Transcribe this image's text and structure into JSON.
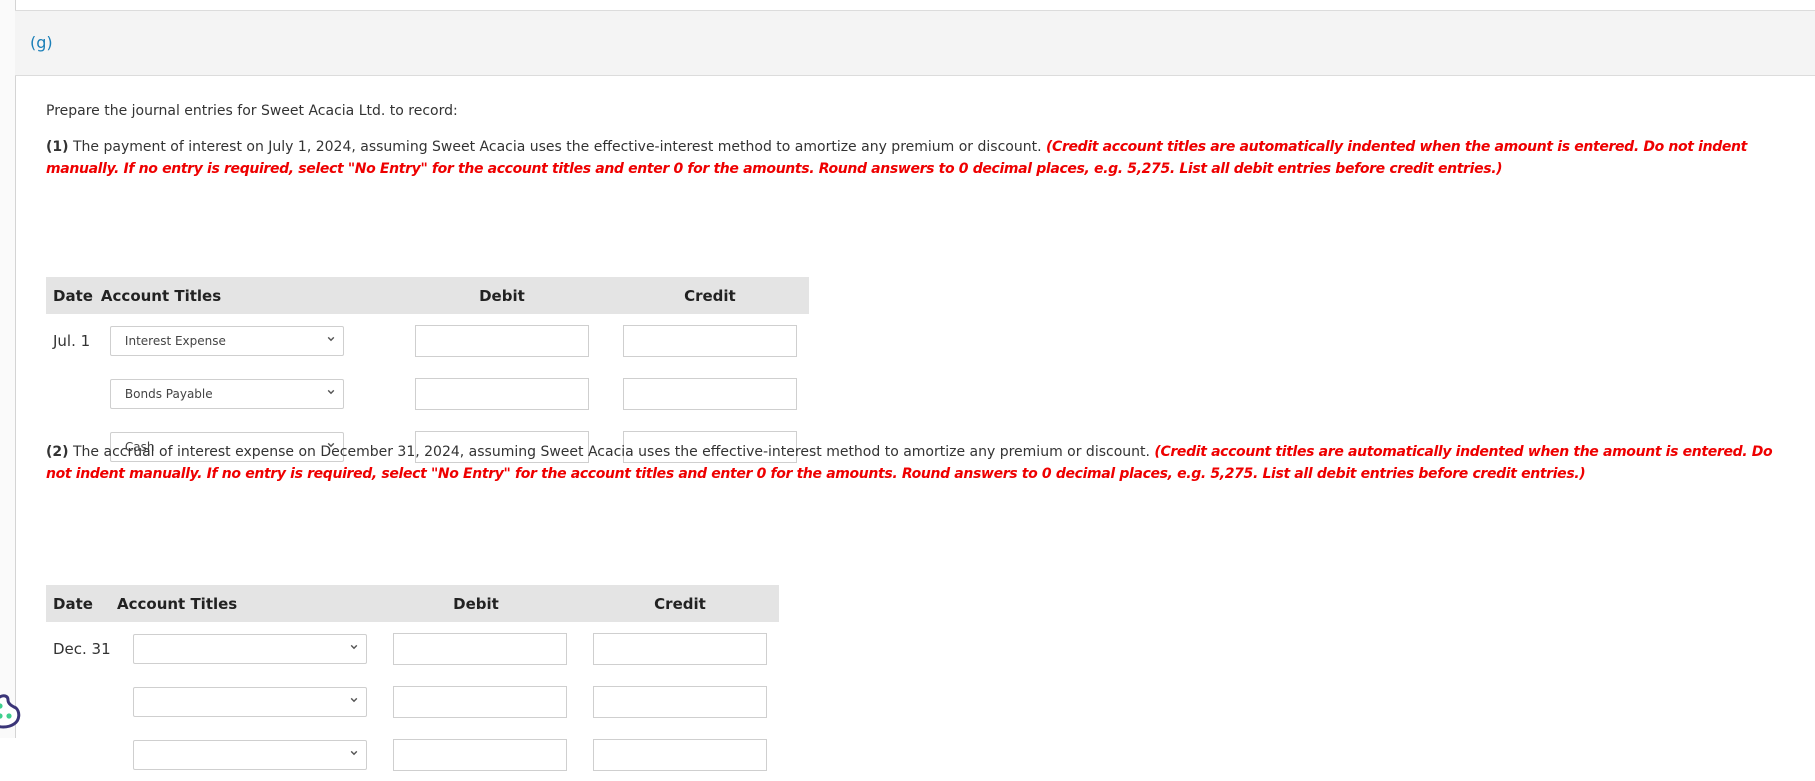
{
  "part": {
    "label": "(g)"
  },
  "intro": "Prepare the journal entries for Sweet Acacia Ltd. to record:",
  "questions": [
    {
      "number": "(1)",
      "text": " The payment of interest on July 1, 2024, assuming Sweet Acacia uses the effective-interest method to amortize any premium or discount. ",
      "instructions": "(Credit account titles are automatically indented when the amount is entered. Do not indent manually. If no entry is required, select \"No Entry\" for the account titles and enter 0 for the amounts. Round answers to 0 decimal places, e.g. 5,275. List all debit entries before credit entries.)",
      "table": {
        "headers": {
          "date": "Date",
          "account": "Account Titles",
          "debit": "Debit",
          "credit": "Credit"
        },
        "rows": [
          {
            "date": "Jul. 1",
            "account": "Interest Expense",
            "debit": "",
            "credit": ""
          },
          {
            "date": "",
            "account": "Bonds Payable",
            "debit": "",
            "credit": ""
          },
          {
            "date": "",
            "account": "Cash",
            "debit": "",
            "credit": ""
          }
        ]
      }
    },
    {
      "number": "(2)",
      "text": " The accrual of interest expense on December 31, 2024, assuming Sweet Acacia uses the effective-interest method to amortize any premium or discount. ",
      "instructions": "(Credit account titles are automatically indented when the amount is entered. Do not indent manually. If no entry is required, select \"No Entry\" for the account titles and enter 0 for the amounts. Round answers to 0 decimal places, e.g. 5,275. List all debit entries before credit entries.)",
      "table": {
        "headers": {
          "date": "Date",
          "account": "Account Titles",
          "debit": "Debit",
          "credit": "Credit"
        },
        "rows": [
          {
            "date": "Dec. 31",
            "account": "",
            "debit": "",
            "credit": ""
          },
          {
            "date": "",
            "account": "",
            "debit": "",
            "credit": ""
          },
          {
            "date": "",
            "account": "",
            "debit": "",
            "credit": ""
          }
        ]
      }
    }
  ],
  "icons": {
    "chevron": "chevron-down-icon",
    "help_widget": "help-chat-icon"
  },
  "colors": {
    "part_label": "#1a7fb8",
    "instructions": "#ee0000",
    "header_bg": "#e4e4e4",
    "panel_header_bg": "#f4f4f4"
  }
}
